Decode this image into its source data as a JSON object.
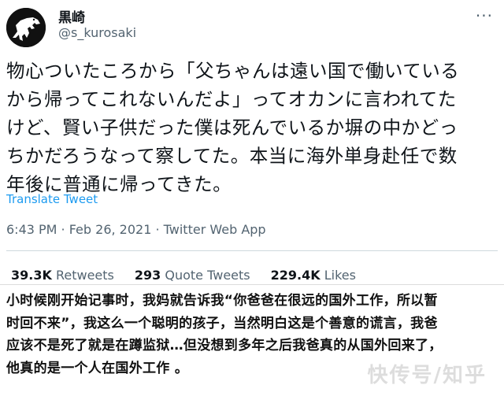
{
  "tweet": {
    "display_name": "黒崎",
    "handle": "@s_kurosaki",
    "more_icon": "ellipsis-icon",
    "lines": [
      "物心ついたころから「父ちゃんは遠い国で働いている",
      "から帰ってこれないんだよ」ってオカンに言われてた",
      "けど、賢い子供だった僕は死んでいるか塀の中かどっ",
      "ちかだろうなって察してた。本当に海外単身赴任で数",
      "年後に普通に帰ってきた。"
    ],
    "translate_label": "Translate Tweet",
    "meta": "6:43 PM · Feb 26, 2021 · Twitter Web App",
    "stats": {
      "retweets_count": "39.3K",
      "retweets_label": "Retweets",
      "quotes_count": "293",
      "quotes_label": "Quote Tweets",
      "likes_count": "229.4K",
      "likes_label": "Likes"
    }
  },
  "caption": {
    "lines": [
      "小时候刚开始记事时，我妈就告诉我“你爸爸在很远的国外工作，所以暂",
      "时回不来”，我这么一个聪明的孩子，当然明白这是个善意的谎言，我爸",
      "应该不是死了就是在蹲监狱…但没想到多年之后我爸真的从国外回来了，",
      "他真的是一个人在国外工作 。"
    ]
  },
  "watermark": "快传号/知乎"
}
